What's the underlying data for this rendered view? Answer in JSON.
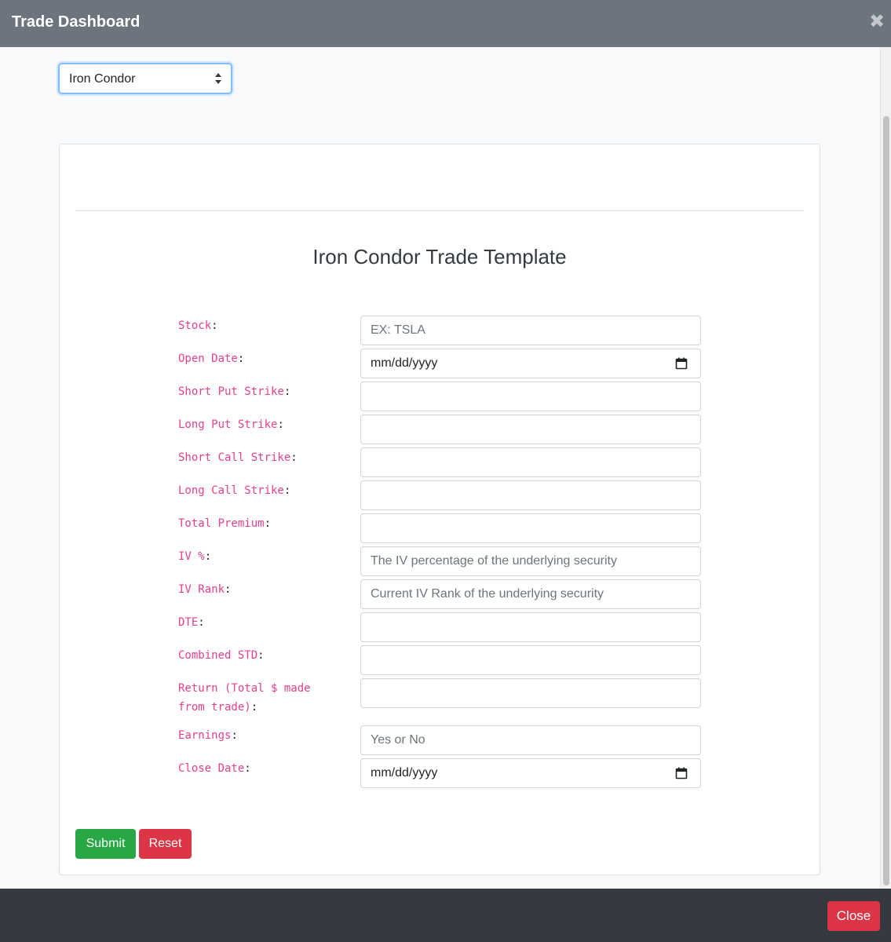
{
  "header": {
    "title": "Trade Dashboard",
    "close_icon": "close-icon"
  },
  "strategy_select": {
    "selected": "Iron Condor"
  },
  "form": {
    "title": "Iron Condor Trade Template",
    "fields": [
      {
        "label": "Stock",
        "type": "text",
        "placeholder": "EX: TSLA",
        "value": ""
      },
      {
        "label": "Open Date",
        "type": "date",
        "placeholder": "mm/dd/yyyy",
        "value": ""
      },
      {
        "label": "Short Put Strike",
        "type": "text",
        "placeholder": "",
        "value": ""
      },
      {
        "label": "Long Put Strike",
        "type": "text",
        "placeholder": "",
        "value": ""
      },
      {
        "label": "Short Call Strike",
        "type": "text",
        "placeholder": "",
        "value": ""
      },
      {
        "label": "Long Call Strike",
        "type": "text",
        "placeholder": "",
        "value": ""
      },
      {
        "label": "Total Premium",
        "type": "text",
        "placeholder": "",
        "value": ""
      },
      {
        "label": "IV %",
        "type": "text",
        "placeholder": "The IV percentage of the underlying security",
        "value": ""
      },
      {
        "label": "IV Rank",
        "type": "text",
        "placeholder": "Current IV Rank of the underlying security",
        "value": ""
      },
      {
        "label": "DTE",
        "type": "text",
        "placeholder": "",
        "value": ""
      },
      {
        "label": "Combined STD",
        "type": "text",
        "placeholder": "",
        "value": ""
      },
      {
        "label": "Return (Total $ made from trade)",
        "type": "text",
        "placeholder": "",
        "value": ""
      },
      {
        "label": "Earnings",
        "type": "text",
        "placeholder": "Yes or No",
        "value": ""
      },
      {
        "label": "Close Date",
        "type": "date",
        "placeholder": "mm/dd/yyyy",
        "value": ""
      }
    ],
    "submit_label": "Submit",
    "reset_label": "Reset"
  },
  "footer": {
    "close_label": "Close"
  },
  "colors": {
    "header_bg": "#6c757d",
    "footer_bg": "#343a40",
    "label_pink": "#e83e8c",
    "submit_green": "#28a745",
    "danger_red": "#dc3545",
    "focus_blue": "#80bdff"
  }
}
